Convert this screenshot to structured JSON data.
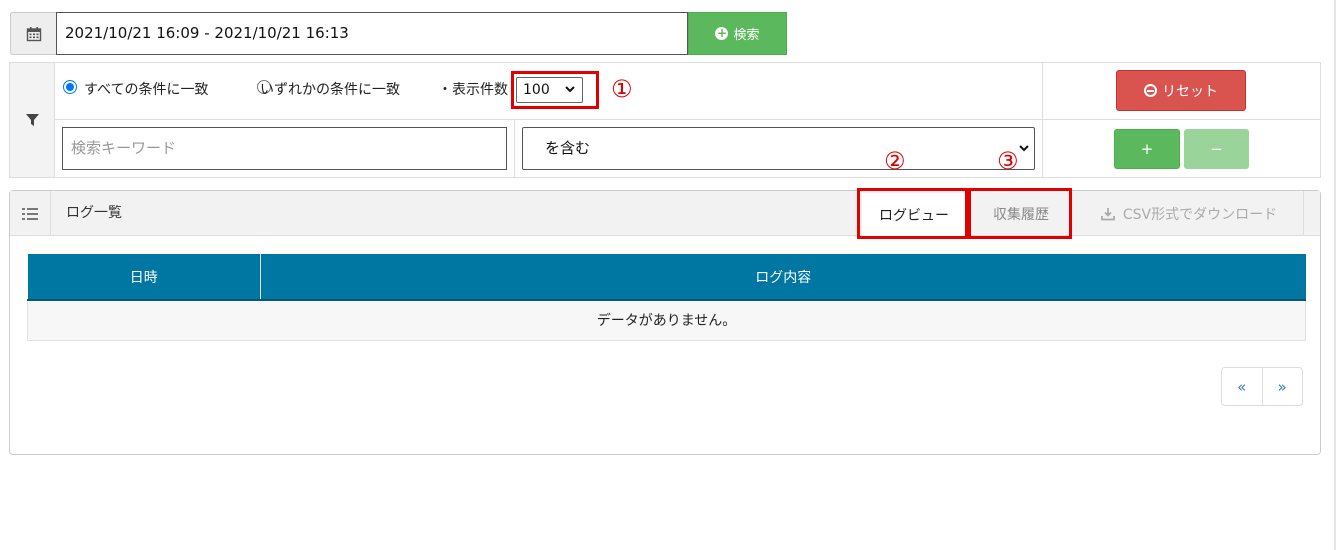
{
  "date_filter": {
    "range_value": "2021/10/21 16:09 - 2021/10/21 16:13",
    "search_label": "検索",
    "calendar_icon": "calendar-icon"
  },
  "filter": {
    "icon": "filter-icon",
    "match_all_label": "すべての条件に一致",
    "match_any_label": "いずれかの条件に一致",
    "match_all_selected": true,
    "display_count_label": "・表示件数",
    "display_count_value": "100",
    "keyword_placeholder": "検索キーワード",
    "condition_value": "を含む",
    "reset_label": "リセット",
    "add_label": "+",
    "remove_label": "−"
  },
  "annotations": {
    "one": "①",
    "two": "②",
    "three": "③",
    "color": "#e00000"
  },
  "log_panel": {
    "title": "ログ一覧",
    "tabs": {
      "log_view": "ログビュー",
      "history": "収集履歴"
    },
    "csv_label": "CSV形式でダウンロード",
    "columns": [
      "日時",
      "ログ内容"
    ],
    "empty_message": "データがありません。",
    "pager": {
      "prev": "«",
      "next": "»"
    }
  },
  "colors": {
    "header_blue": "#0076a3",
    "green": "#5cb85c",
    "red": "#d9534f"
  }
}
